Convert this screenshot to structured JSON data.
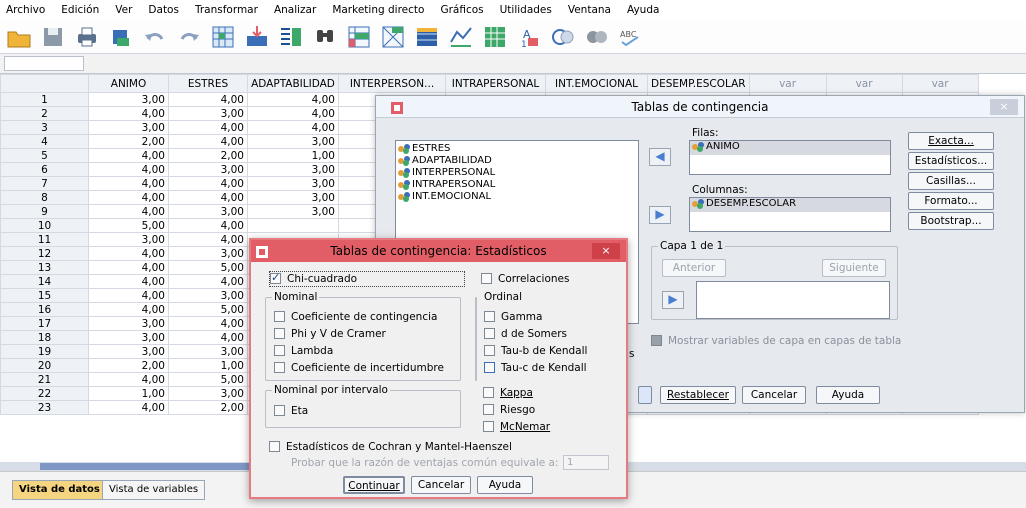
{
  "menu": [
    "Archivo",
    "Edición",
    "Ver",
    "Datos",
    "Transformar",
    "Analizar",
    "Marketing directo",
    "Gráficos",
    "Utilidades",
    "Ventana",
    "Ayuda"
  ],
  "toolbar": {
    "icons": [
      "open-folder-icon",
      "save-icon",
      "print-icon",
      "dialog-recall-icon",
      "undo-icon",
      "redo-icon",
      "goto-case-icon",
      "goto-variable-icon",
      "variables-icon",
      "find-icon",
      "insert-cases-icon",
      "insert-variable-icon",
      "split-file-icon",
      "weight-cases-icon",
      "select-cases-icon",
      "value-labels-icon",
      "use-sets-icon",
      "show-sets-icon",
      "spelling-icon"
    ],
    "spelling_label": "ABC"
  },
  "grid": {
    "columns": [
      "ANIMO",
      "ESTRES",
      "ADAPTABILIDAD",
      "INTERPERSON...",
      "INTRAPERSONAL",
      "INT.EMOCIONAL",
      "DESEMP.ESCOLAR",
      "var",
      "var",
      "var"
    ],
    "rows": [
      {
        "n": "1",
        "animo": "3,00",
        "estres": "4,00",
        "adapt": "4,00"
      },
      {
        "n": "2",
        "animo": "4,00",
        "estres": "3,00",
        "adapt": "4,00"
      },
      {
        "n": "3",
        "animo": "3,00",
        "estres": "4,00",
        "adapt": "4,00"
      },
      {
        "n": "4",
        "animo": "2,00",
        "estres": "4,00",
        "adapt": "3,00"
      },
      {
        "n": "5",
        "animo": "4,00",
        "estres": "2,00",
        "adapt": "1,00"
      },
      {
        "n": "6",
        "animo": "4,00",
        "estres": "3,00",
        "adapt": "3,00"
      },
      {
        "n": "7",
        "animo": "4,00",
        "estres": "4,00",
        "adapt": "3,00"
      },
      {
        "n": "8",
        "animo": "4,00",
        "estres": "4,00",
        "adapt": "3,00"
      },
      {
        "n": "9",
        "animo": "4,00",
        "estres": "3,00",
        "adapt": "3,00"
      },
      {
        "n": "10",
        "animo": "5,00",
        "estres": "4,00",
        "adapt": ""
      },
      {
        "n": "11",
        "animo": "3,00",
        "estres": "4,00",
        "adapt": ""
      },
      {
        "n": "12",
        "animo": "4,00",
        "estres": "3,00",
        "adapt": ""
      },
      {
        "n": "13",
        "animo": "4,00",
        "estres": "5,00",
        "adapt": ""
      },
      {
        "n": "14",
        "animo": "4,00",
        "estres": "4,00",
        "adapt": ""
      },
      {
        "n": "15",
        "animo": "4,00",
        "estres": "3,00",
        "adapt": ""
      },
      {
        "n": "16",
        "animo": "4,00",
        "estres": "5,00",
        "adapt": ""
      },
      {
        "n": "17",
        "animo": "3,00",
        "estres": "4,00",
        "adapt": ""
      },
      {
        "n": "18",
        "animo": "3,00",
        "estres": "4,00",
        "adapt": ""
      },
      {
        "n": "19",
        "animo": "3,00",
        "estres": "3,00",
        "adapt": ""
      },
      {
        "n": "20",
        "animo": "2,00",
        "estres": "1,00",
        "adapt": ""
      },
      {
        "n": "21",
        "animo": "4,00",
        "estres": "5,00",
        "adapt": ""
      },
      {
        "n": "22",
        "animo": "1,00",
        "estres": "3,00",
        "adapt": ""
      },
      {
        "n": "23",
        "animo": "4,00",
        "estres": "2,00",
        "adapt": ""
      }
    ],
    "lower_right": [
      {
        "row": "21",
        "intemo": "4,00",
        "desemp": "2,00"
      },
      {
        "row": "22",
        "intemo": "2,00",
        "desemp": "2,00"
      },
      {
        "row": "23",
        "intemo": "4,00",
        "desemp": "2,00"
      }
    ]
  },
  "tabs": {
    "data_view": "Vista de datos",
    "variable_view": "Vista de variables"
  },
  "crosstabs": {
    "title": "Tablas de contingencia",
    "close": "×",
    "source_vars": [
      "ESTRES",
      "ADAPTABILIDAD",
      "INTERPERSONAL",
      "INTRAPERSONAL",
      "INT.EMOCIONAL"
    ],
    "rows_label": "Filas:",
    "rows_vars": [
      "ANIMO"
    ],
    "cols_label": "Columnas:",
    "cols_vars": [
      "DESEMP.ESCOLAR"
    ],
    "layer_label": "Capa 1 de 1",
    "prev": "Anterior",
    "next": "Siguiente",
    "show_layers": "Mostrar variables de capa en capas de tabla",
    "side_buttons": [
      "Exacta...",
      "Estadísticos...",
      "Casillas...",
      "Formato...",
      "Bootstrap..."
    ],
    "reset": "Restablecer",
    "cancel": "Cancelar",
    "help": "Ayuda",
    "partial_s": "s"
  },
  "stats": {
    "title": "Tablas de contingencia: Estadísticos",
    "close": "×",
    "chi": "Chi-cuadrado",
    "correlations": "Correlaciones",
    "nominal_title": "Nominal",
    "nominal": [
      "Coeficiente de contingencia",
      "Phi y V de Cramer",
      "Lambda",
      "Coeficiente de incertidumbre"
    ],
    "ordinal_title": "Ordinal",
    "ordinal": [
      "Gamma",
      "d de Somers",
      "Tau-b de Kendall",
      "Tau-c de Kendall"
    ],
    "interval_title": "Nominal por intervalo",
    "eta": "Eta",
    "kappa": "Kappa",
    "risk": "Riesgo",
    "mcnemar": "McNemar",
    "cochran": "Estadísticos de Cochran y Mantel-Haenszel",
    "odds_label": "Probar que la razón de ventajas común equivale a:",
    "odds_value": "1",
    "continue": "Continuar",
    "cancel": "Cancelar",
    "help": "Ayuda"
  },
  "colors": {
    "accent": "#e25e66",
    "selection": "#d6d9df",
    "tab_active": "#f5d580"
  }
}
